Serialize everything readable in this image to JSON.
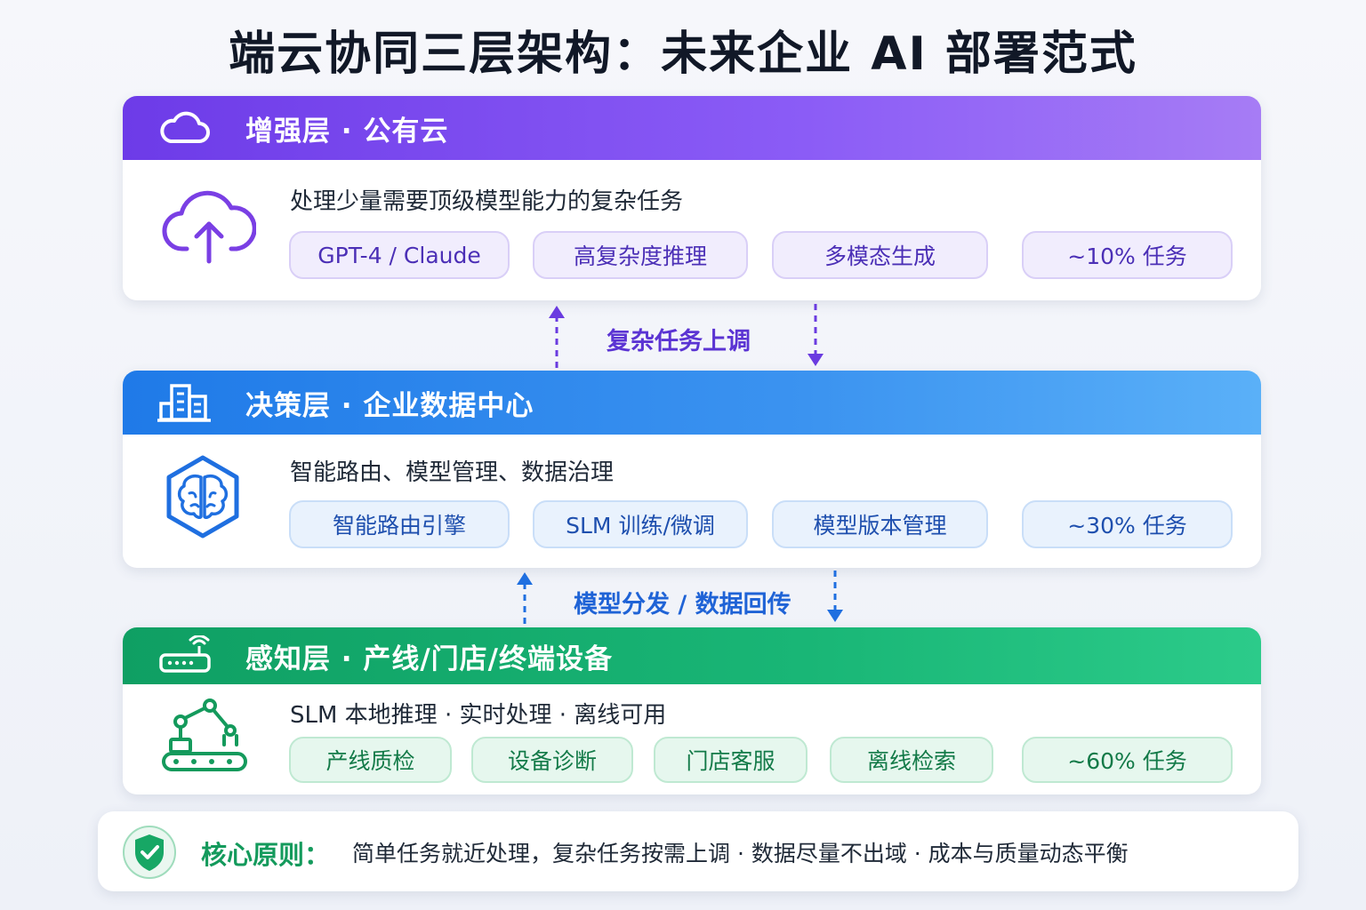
{
  "title": "端云协同三层架构：未来企业 AI 部署范式",
  "layers": {
    "cloud": {
      "title": "增强层 · 公有云",
      "desc": "处理少量需要顶级模型能力的复杂任务",
      "tags": [
        "GPT-4 / Claude",
        "高复杂度推理",
        "多模态生成",
        "~10% 任务"
      ],
      "head_icon": "cloud-icon",
      "body_icon": "cloud-upload-icon",
      "color": "#7c4dee"
    },
    "datacenter": {
      "title": "决策层 · 企业数据中心",
      "desc": "智能路由、模型管理、数据治理",
      "tags": [
        "智能路由引擎",
        "SLM 训练/微调",
        "模型版本管理",
        "~30% 任务"
      ],
      "head_icon": "building-icon",
      "body_icon": "brain-hexagon-icon",
      "color": "#2f86ee"
    },
    "edge": {
      "title": "感知层 · 产线/门店/终端设备",
      "desc": "SLM 本地推理 · 实时处理 · 离线可用",
      "tags": [
        "产线质检",
        "设备诊断",
        "门店客服",
        "离线检索",
        "~60% 任务"
      ],
      "head_icon": "router-icon",
      "body_icon": "robot-arm-icon",
      "color": "#16ab6c"
    }
  },
  "connectors": {
    "cloud_dc": "复杂任务上调",
    "dc_edge": "模型分发 / 数据回传"
  },
  "footer": {
    "label": "核心原则：",
    "text": "简单任务就近处理，复杂任务按需上调 · 数据尽量不出域 · 成本与质量动态平衡",
    "icon": "shield-check-icon"
  }
}
